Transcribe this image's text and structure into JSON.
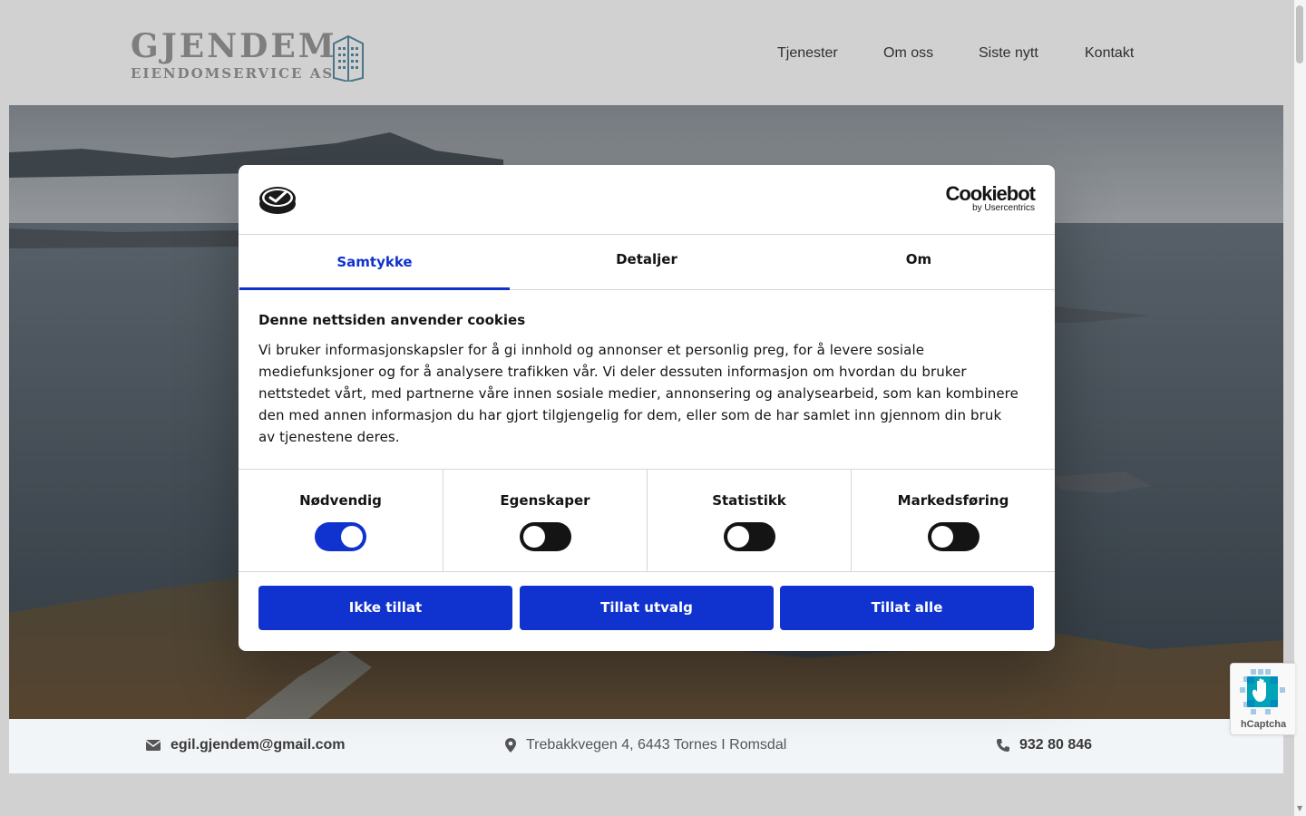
{
  "header": {
    "logo": {
      "name": "GJENDEM",
      "subtitle": "EIENDOMSERVICE AS",
      "icon": "building-icon",
      "color": "#9a9a9a",
      "accent": "#5d8fa8"
    },
    "nav": [
      {
        "label": "Tjenester"
      },
      {
        "label": "Om oss"
      },
      {
        "label": "Siste nytt"
      },
      {
        "label": "Kontakt"
      }
    ]
  },
  "contact": {
    "email": {
      "icon": "envelope-icon",
      "text": "egil.gjendem@gmail.com"
    },
    "address": {
      "icon": "map-pin-icon",
      "text": "Trebakkvegen 4, 6443 Tornes I Romsdal"
    },
    "phone": {
      "icon": "phone-icon",
      "text": "932 80 846"
    }
  },
  "cookie_dialog": {
    "logo_icon": "cookie-logo-icon",
    "brand": {
      "name": "Cookiebot",
      "byline": "by Usercentrics"
    },
    "tabs": [
      {
        "label": "Samtykke",
        "active": true
      },
      {
        "label": "Detaljer",
        "active": false
      },
      {
        "label": "Om",
        "active": false
      }
    ],
    "title": "Denne nettsiden anvender cookies",
    "text": "Vi bruker informasjonskapsler for å gi innhold og annonser et personlig preg, for å levere sosiale mediefunksjoner og for å analysere trafikken vår. Vi deler dessuten informasjon om hvordan du bruker nettstedet vårt, med partnerne våre innen sosiale medier, annonsering og analysearbeid, som kan kombinere den med annen informasjon du har gjort tilgjengelig for dem, eller som de har samlet inn gjennom din bruk av tjenestene deres.",
    "categories": [
      {
        "label": "Nødvendig",
        "enabled": true
      },
      {
        "label": "Egenskaper",
        "enabled": false
      },
      {
        "label": "Statistikk",
        "enabled": false
      },
      {
        "label": "Markedsføring",
        "enabled": false
      }
    ],
    "buttons": {
      "deny": "Ikke tillat",
      "allow_selection": "Tillat utvalg",
      "allow_all": "Tillat alle"
    },
    "accent_color": "#1032cf"
  },
  "hcaptcha": {
    "label": "hCaptcha",
    "icon": "hcaptcha-hand-icon"
  }
}
